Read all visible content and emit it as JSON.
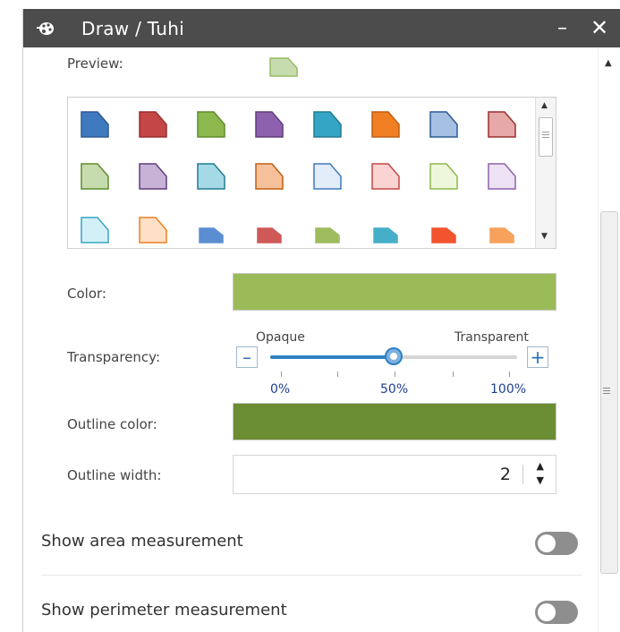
{
  "window": {
    "title": "Draw / Tuhi",
    "minimize_label": "–",
    "close_label": "✕",
    "app_icon": "palette-icon"
  },
  "preview": {
    "label": "Preview:",
    "fill": "#c7dcae",
    "stroke": "#98bb67"
  },
  "symbol_palette": {
    "rows": [
      [
        {
          "fill": "#3f7abf",
          "stroke": "#2b5a93"
        },
        {
          "fill": "#c44747",
          "stroke": "#9a2f2f"
        },
        {
          "fill": "#8db84d",
          "stroke": "#5f8c2b"
        },
        {
          "fill": "#8e61ae",
          "stroke": "#5e3d7d"
        },
        {
          "fill": "#34a5c4",
          "stroke": "#217b93"
        },
        {
          "fill": "#ef7f22",
          "stroke": "#c15f12"
        },
        {
          "fill": "#a6c0e3",
          "stroke": "#2b5a93"
        },
        {
          "fill": "#e6a8a8",
          "stroke": "#9a2f2f"
        }
      ],
      [
        {
          "fill": "#c7dcae",
          "stroke": "#5f8c2b"
        },
        {
          "fill": "#c6b3d6",
          "stroke": "#5e3d7d"
        },
        {
          "fill": "#a6d9e6",
          "stroke": "#217b93"
        },
        {
          "fill": "#f6c19a",
          "stroke": "#c15f12"
        },
        {
          "fill": "#e3ecf9",
          "stroke": "#3f7abf"
        },
        {
          "fill": "#fbd3d3",
          "stroke": "#c44747"
        },
        {
          "fill": "#eef7dc",
          "stroke": "#8db84d"
        },
        {
          "fill": "#ece2f3",
          "stroke": "#8e61ae"
        }
      ],
      [
        {
          "fill": "#d4f0f7",
          "stroke": "#34a5c4",
          "shape": "large"
        },
        {
          "fill": "#fde0c6",
          "stroke": "#ef7f22",
          "shape": "large"
        },
        {
          "fill": "#5b8ed1",
          "stroke": "#5b8ed1",
          "shape": "small"
        },
        {
          "fill": "#cf5959",
          "stroke": "#cf5959",
          "shape": "small"
        },
        {
          "fill": "#9ebc5e",
          "stroke": "#9ebc5e",
          "shape": "small"
        },
        {
          "fill": "#46aec8",
          "stroke": "#46aec8",
          "shape": "small"
        },
        {
          "fill": "#f1542e",
          "stroke": "#f1542e",
          "shape": "small"
        },
        {
          "fill": "#f6a25c",
          "stroke": "#f6a25c",
          "shape": "small"
        }
      ]
    ]
  },
  "color": {
    "label": "Color:",
    "value": "#9bbb59"
  },
  "transparency": {
    "label": "Transparency:",
    "opaque_label": "Opaque",
    "transparent_label": "Transparent",
    "minus_label": "–",
    "plus_label": "+",
    "value_percent": 50,
    "ticks": [
      "0%",
      "50%",
      "100%"
    ]
  },
  "outline_color": {
    "label": "Outline color:",
    "value": "#6b8d34"
  },
  "outline_width": {
    "label": "Outline width:",
    "value": "2",
    "up_icon": "▲",
    "down_icon": "▼"
  },
  "toggles": {
    "area_label": "Show area measurement",
    "area_on": false,
    "perimeter_label": "Show perimeter measurement",
    "perimeter_on": false
  }
}
